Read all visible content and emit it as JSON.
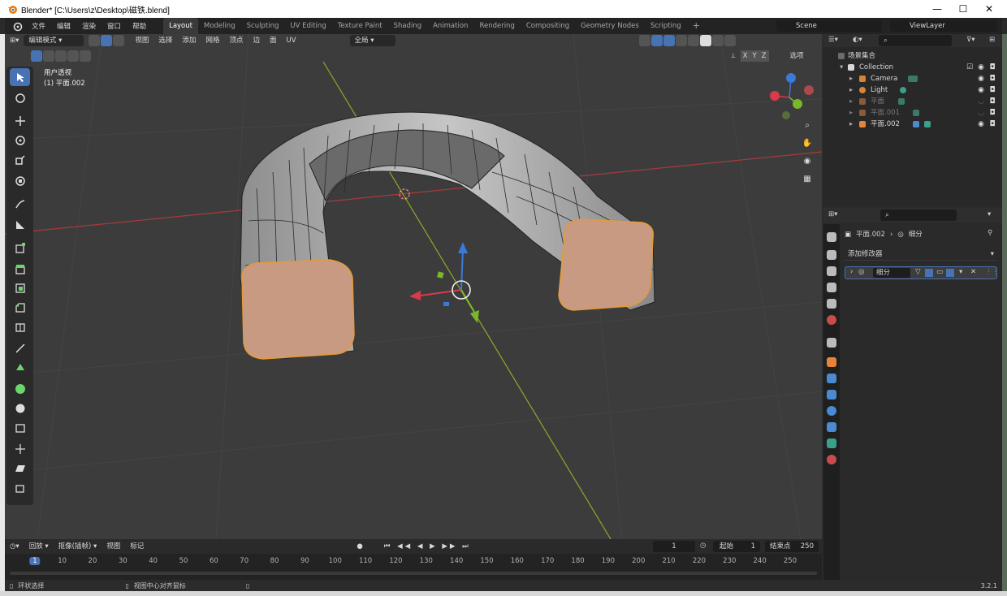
{
  "titlebar": {
    "title": "Blender* [C:\\Users\\z\\Desktop\\磁铁.blend]",
    "minimize": "—",
    "maximize": "☐",
    "close": "✕"
  },
  "menubar": {
    "items": [
      "文件",
      "编辑",
      "渲染",
      "窗口",
      "帮助"
    ]
  },
  "workspaces": {
    "tabs": [
      "Layout",
      "Modeling",
      "Sculpting",
      "UV Editing",
      "Texture Paint",
      "Shading",
      "Animation",
      "Rendering",
      "Compositing",
      "Geometry Nodes",
      "Scripting"
    ],
    "active": "Layout",
    "add": "+"
  },
  "scene": {
    "name": "Scene",
    "viewlayer": "ViewLayer"
  },
  "viewport_header": {
    "mode": "编辑模式",
    "menus": [
      "视图",
      "选择",
      "添加",
      "网格",
      "顶点",
      "边",
      "面",
      "UV"
    ],
    "transform_orientation": "全局",
    "axes": [
      "X",
      "Y",
      "Z"
    ],
    "options": "选项"
  },
  "viewport": {
    "view_name": "用户透视",
    "object_info": "(1) 平面.002"
  },
  "outliner": {
    "scene_collection": "场景集合",
    "items": [
      {
        "name": "Collection",
        "depth": 1
      },
      {
        "name": "Camera",
        "depth": 2
      },
      {
        "name": "Light",
        "depth": 2
      },
      {
        "name": "平面",
        "depth": 2
      },
      {
        "name": "平面.001",
        "depth": 2
      },
      {
        "name": "平面.002",
        "depth": 2
      }
    ]
  },
  "properties": {
    "object_name": "平面.002",
    "modifier_context": "细分",
    "add_modifier": "添加修改器",
    "modifier_name": "细分"
  },
  "timeline": {
    "menus": [
      "回放",
      "抠像(插帧)",
      "视图",
      "标记"
    ],
    "current_frame": "1",
    "start_label": "起始",
    "start": "1",
    "end_label": "结束点",
    "end": "250",
    "ruler": [
      "1",
      "10",
      "20",
      "30",
      "40",
      "50",
      "60",
      "70",
      "80",
      "90",
      "100",
      "110",
      "120",
      "130",
      "140",
      "150",
      "160",
      "170",
      "180",
      "190",
      "200",
      "210",
      "220",
      "230",
      "240",
      "250"
    ]
  },
  "statusbar": {
    "left": "环状选择",
    "middle": "视图中心对齐鼠标",
    "version": "3.2.1"
  },
  "colors": {
    "accent": "#4772b3",
    "face_selected": "#c89a82",
    "edge_selected": "#e59a38",
    "x_axis": "#a83a3a",
    "y_axis": "#8aaa2a"
  }
}
